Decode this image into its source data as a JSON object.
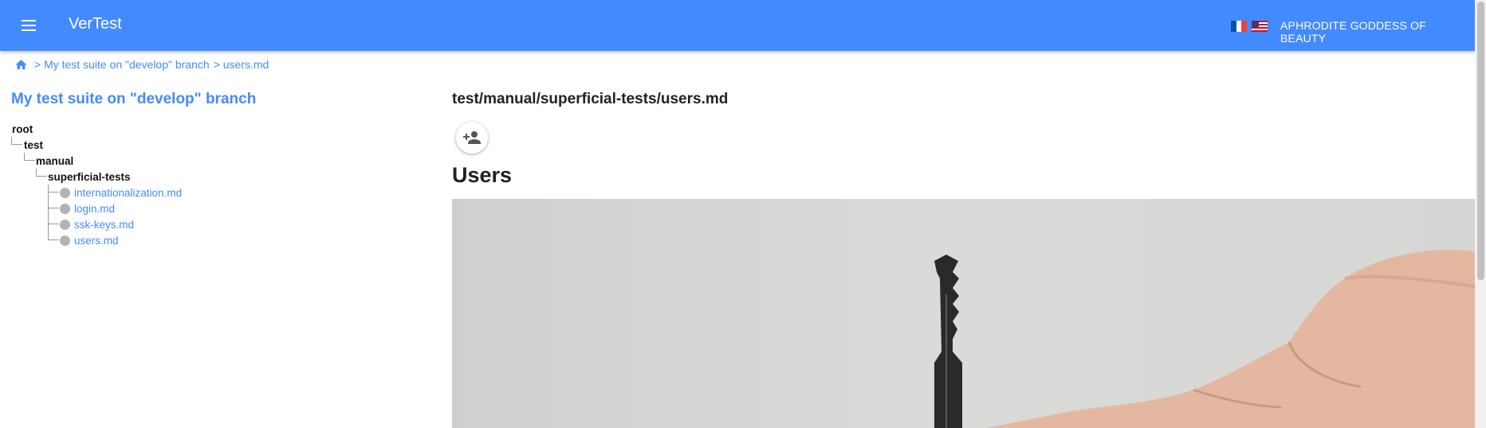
{
  "header": {
    "title": "VerTest",
    "menu_icon": "menu-icon",
    "languages": [
      "fr",
      "en-us"
    ],
    "user": "APHRODITE GODDESS OF BEAUTY",
    "color": "#448aff"
  },
  "breadcrumb": {
    "home_icon": "home-icon",
    "items": [
      "> My test suite on \"develop\" branch",
      "> users.md"
    ]
  },
  "sidebar": {
    "title": "My test suite on \"develop\" branch",
    "tree": {
      "root": "root",
      "test": "test",
      "manual": "manual",
      "superficial": "superficial-tests",
      "files": [
        "internationalization.md",
        "login.md",
        "ssk-keys.md",
        "users.md"
      ]
    }
  },
  "main": {
    "path": "test/manual/superficial-tests/users.md",
    "assign_icon": "add-person-icon",
    "heading": "Users",
    "image": "photo of a hand holding a key"
  }
}
